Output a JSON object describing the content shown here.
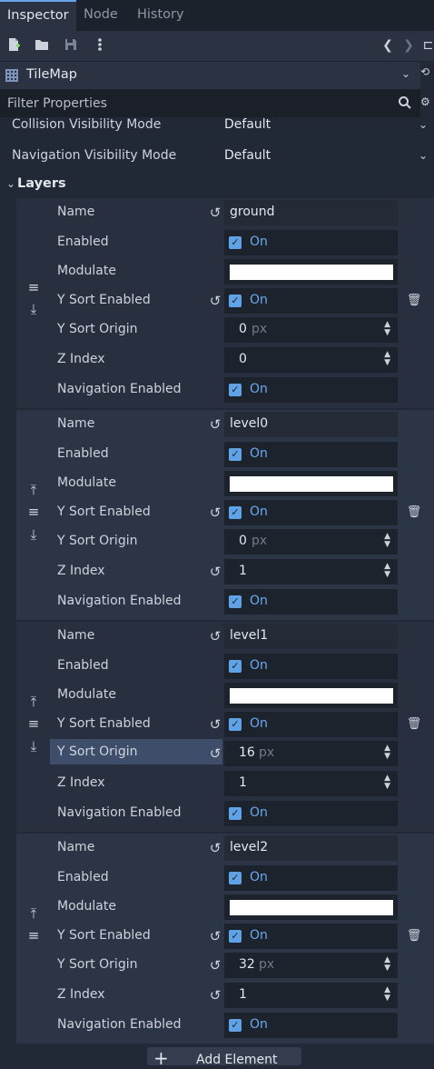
{
  "tabs": [
    "Inspector",
    "Node",
    "History"
  ],
  "toolbar": {
    "icons": [
      "new-resource-icon",
      "open-folder-icon",
      "save-icon",
      "more-icon",
      "back-icon",
      "forward-icon"
    ]
  },
  "node": {
    "name": "TileMap",
    "icon": "tilemap-grid-icon"
  },
  "filter": {
    "placeholder": "Filter Properties"
  },
  "props": [
    {
      "label": "Collision Visibility Mode",
      "value": "Default"
    },
    {
      "label": "Navigation Visibility Mode",
      "value": "Default"
    }
  ],
  "section": {
    "label": "Layers"
  },
  "labels": {
    "name": "Name",
    "enabled": "Enabled",
    "modulate": "Modulate",
    "ysort_enabled": "Y Sort Enabled",
    "ysort_origin": "Y Sort Origin",
    "z_index": "Z Index",
    "nav_enabled": "Navigation Enabled",
    "on": "On",
    "px": "px"
  },
  "layers": [
    {
      "name": "ground",
      "y_sort_origin": "0",
      "z_index": "0",
      "modulate": "#ffffff"
    },
    {
      "name": "level0",
      "y_sort_origin": "0",
      "z_index": "1",
      "modulate": "#ffffff"
    },
    {
      "name": "level1",
      "y_sort_origin": "16",
      "z_index": "1",
      "modulate": "#ffffff"
    },
    {
      "name": "level2",
      "y_sort_origin": "32",
      "z_index": "1",
      "modulate": "#ffffff"
    }
  ],
  "add_button": {
    "label": "Add Element"
  },
  "colors": {
    "accent": "#6aa4e8",
    "checkbox": "#5fa2e6",
    "highlight": "#3e4e6a"
  }
}
